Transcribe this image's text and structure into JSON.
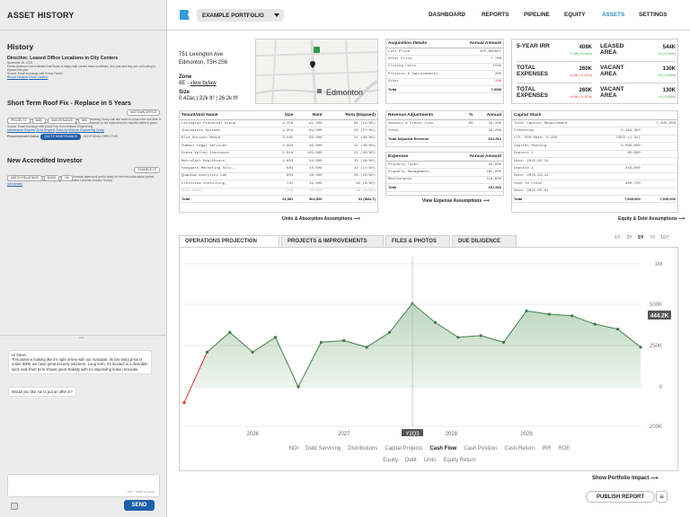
{
  "app": {
    "title": "ASSET HISTORY"
  },
  "history": {
    "title": "History",
    "entries": [
      {
        "title": "Directive: Leased Office Locations in City Centers",
        "date": "November 28, 2024",
        "body": "Emma Anderson has indicated that Bowie is happy with current lease conditions, this year and they are not looking to expand this plan.",
        "source": "Source: Email exchange with Emma Fielder",
        "links": [
          "Record Decision",
          "Gloss Creation"
        ]
      },
      {
        "title": "Short Term Roof Fix - Replace in 5 Years",
        "pills": [
          "PROJECTS",
          "$46K",
          "MAINTENANCE",
          "$9K"
        ],
        "pill_right": "MIDTOWN OFFICE",
        "body": "Ollum Presside from Welsh Inc and David Paw from Midtown Engineering Group visit last week to inspect the roof fleet. A small maintenance contract can be placed to fix leaking for now, however a roof replacement is required within 5 years.",
        "source": "Source: Email exchange with David Paw from Midtown Engineering",
        "links": [
          "Maintenance Request",
          "Gloss Request",
          "Check list",
          "Midtown Engineering Group"
        ],
        "rec_label": "Recommended Action:",
        "rec_action": "QUOTE MAINTENANCE",
        "rec_secondary": "ADDITIONAL DIRECTIVE"
      },
      {
        "title": "New Accredited Investor",
        "pills": [
          "MATCH RELATIONS",
          "$240K",
          "HK"
        ],
        "pill_right": "EXAMPLE LP",
        "body": "Beati Alemaship has completed all of his accredited investor paperwork and is ready for the next subscription period.",
        "source": "Source: Email from Hanley Alemaship, signed Document Londown Investor Survey",
        "links": [
          "Add Identity"
        ]
      }
    ]
  },
  "chat": {
    "messages": [
      "Hi Steve,",
      "This asset is looking like it's right in-line with our mandate. Its low entry price is under 800K we have great security mid-term. Long term, it's located in a desirable spot, and short term shows great stability with no impending lease renewals.",
      "Would you like me to put an offer in?"
    ],
    "input_hint": "ctrl + enter to send",
    "send_label": "SEND"
  },
  "nav": {
    "portfolio": "EXAMPLE PORTFOLIO",
    "items": [
      "DASHBOARD",
      "REPORTS",
      "PIPELINE",
      "EQUITY",
      "ASSETS",
      "SETTINGS"
    ],
    "active": "ASSETS"
  },
  "property": {
    "address1": "751 Lexington Ave",
    "address2": "Edmonton, T5H 2S6",
    "zone_label": "Zone",
    "zone_value": "8E - ",
    "zone_link": "view bylaw",
    "size_label": "Size",
    "size_value": "0.42ac | 32k ft² | 26.2k ft²",
    "map_city": "Edmonton"
  },
  "acquisition": {
    "title": "Acquisition Details",
    "amount_header": "Annual Amount",
    "rows": [
      {
        "label": "List Price",
        "value": "OFF-MARKET",
        "valueColor": "#555"
      },
      {
        "label": "Offer Price",
        "value": "7.75M",
        "valueColor": "#555"
      },
      {
        "label": "Closing Costs",
        "value": "155K",
        "valueColor": "#555"
      },
      {
        "label": "Projects & Improvements",
        "value": "20K",
        "valueColor": "#555"
      },
      {
        "label": "Other",
        "value": "-10K",
        "valueColor": "#d33"
      }
    ],
    "total_label": "Total",
    "total_value": "7.9SM"
  },
  "kpis": [
    {
      "label": "5-YEAR IRR",
      "value": "408K",
      "change": "+1.8K (+0.44%)",
      "dir": "up"
    },
    {
      "label": "LEASED AREA",
      "value": "544K",
      "change": "+0 (+0.00%)",
      "dir": "up"
    },
    {
      "label": "TOTAL EXPENSES",
      "value": "260K",
      "change": "+4.9K (+1.87%)",
      "dir": "down"
    },
    {
      "label": "VACANT AREA",
      "value": "130K",
      "change": "+0 (+0.00%)",
      "dir": "up"
    },
    {
      "label": "TOTAL EXPENSES",
      "value": "260K",
      "change": "+4.9K (+1.87%)",
      "dir": "down"
    },
    {
      "label": "VACANT AREA",
      "value": "130K",
      "change": "+0 (+0.00%)",
      "dir": "up"
    }
  ],
  "tenants": {
    "headers": [
      "Tenant/Unit Name",
      "Size",
      "Rent",
      "Term (Elapsed)"
    ],
    "rows": [
      [
        "Lexington Financial Group",
        "4,759",
        "91,000",
        "80 (14/66)"
      ],
      [
        "Innovatech Systems",
        "3,353",
        "84,000",
        "33 (27/60)"
      ],
      [
        "Blue Horizon Media",
        "3,045",
        "40,000",
        "21 (40/60)"
      ],
      [
        "Summit Legal Services",
        "2,993",
        "45,000",
        "21 (40/60)"
      ],
      [
        "Green Valley Insurance",
        "5,918",
        "125,000",
        "21 (40/60)"
      ],
      [
        "MetroPath Healthcare",
        "1,683",
        "54,000",
        "45 (18/60)"
      ],
      [
        "Vanguard Marketing Solu...",
        "883",
        "18,000",
        "42 (17/60)"
      ],
      [
        "Quantum Analytics Lab",
        "804",
        "18,500",
        "30 (15/60)"
      ],
      [
        "Crestview Consulting",
        "731",
        "15,800",
        "82 (0/60)"
      ],
      [
        "Unit #203",
        "229",
        "10,800",
        "20 (5/60)"
      ]
    ],
    "total": [
      "Total",
      "24,381",
      "504,500",
      "31 (WALT)"
    ],
    "footer_link": "Units & Absorption Assumptions"
  },
  "revenue": {
    "title": "Revenue Adjustments",
    "pct_header": "%",
    "amount_header": "Annual",
    "rows": [
      [
        "Vacancy & Credit Loss",
        "6%",
        "33,266"
      ],
      [
        "Total",
        "",
        "33,266"
      ]
    ],
    "total": [
      "Total Adjusted Revenue",
      "",
      "521,512"
    ]
  },
  "expenses": {
    "title": "Expenses",
    "amount_header": "Annual Amount",
    "rows": [
      [
        "Property Taxes",
        "94,000"
      ],
      [
        "Property Management",
        "285,000"
      ],
      [
        "Maintenance",
        "118,600"
      ]
    ],
    "total": [
      "Total",
      "497,660"
    ],
    "footer_link": "View Expense Assumptions"
  },
  "capital": {
    "title": "Capital Stack",
    "rows": [
      [
        "Total Capital Requirement",
        "",
        "7,945,000"
      ],
      [
        "Financing",
        "5,164,350",
        ""
      ],
      [
        "LTV: 65%  Rate: 5.15%",
        "DSCR (1.34)",
        ""
      ],
      [
        "Capital Raising",
        "2,000,000",
        ""
      ],
      [
        "Deposit 1",
        "95,000",
        ""
      ],
      [
        "Date: 2025-02-14",
        "",
        ""
      ],
      [
        "Deposit 2",
        "250,000",
        ""
      ],
      [
        "Date: 2025-04-14",
        "",
        ""
      ],
      [
        "Cash To Close",
        "480,750",
        ""
      ],
      [
        "Date: 2025-05-01",
        "",
        ""
      ]
    ],
    "total": [
      "Total",
      "7,945,000",
      "7,945,000"
    ],
    "footer_link": "Equity & Debt Assumptions"
  },
  "tabs": {
    "items": [
      "OPERATIONS PROJECTION",
      "PROJECTS & IMPROVEMENTS",
      "FILES & PHOTOS",
      "DUE DILIGENCE"
    ],
    "active": 0
  },
  "ranges": {
    "items": [
      "1Y",
      "3Y",
      "5Y",
      "7Y",
      "10Y"
    ],
    "active": "5Y"
  },
  "chart_data": {
    "type": "area",
    "y_ticks": [
      "1M",
      "500K",
      "250K",
      "0",
      "-200K"
    ],
    "ylim": [
      -200000,
      1000000
    ],
    "x_labels": [
      "2026",
      "2027",
      "2028",
      "2029"
    ],
    "cursor_label": "Y2Q3",
    "value_badge": "444.2K",
    "series": [
      {
        "values": [
          -80000,
          210000,
          330000,
          210000,
          300000,
          0,
          270000,
          280000,
          240000,
          330000,
          510000,
          390000,
          300000,
          310000,
          270000,
          460000,
          440000,
          430000,
          380000,
          350000,
          240000
        ]
      }
    ]
  },
  "metrics": {
    "row1": [
      "NOI",
      "Debt Servicing",
      "Distributions",
      "Capital Projects",
      "Cash Flow",
      "Cash Position",
      "Cash Return",
      "IRR",
      "ROE"
    ],
    "row2": [
      "Equity",
      "Debt",
      "Units",
      "Equity Return"
    ],
    "active": "Cash Flow"
  },
  "footer": {
    "impact_link": "Show Portfolio Impact",
    "publish_label": "PUBLISH REPORT"
  }
}
